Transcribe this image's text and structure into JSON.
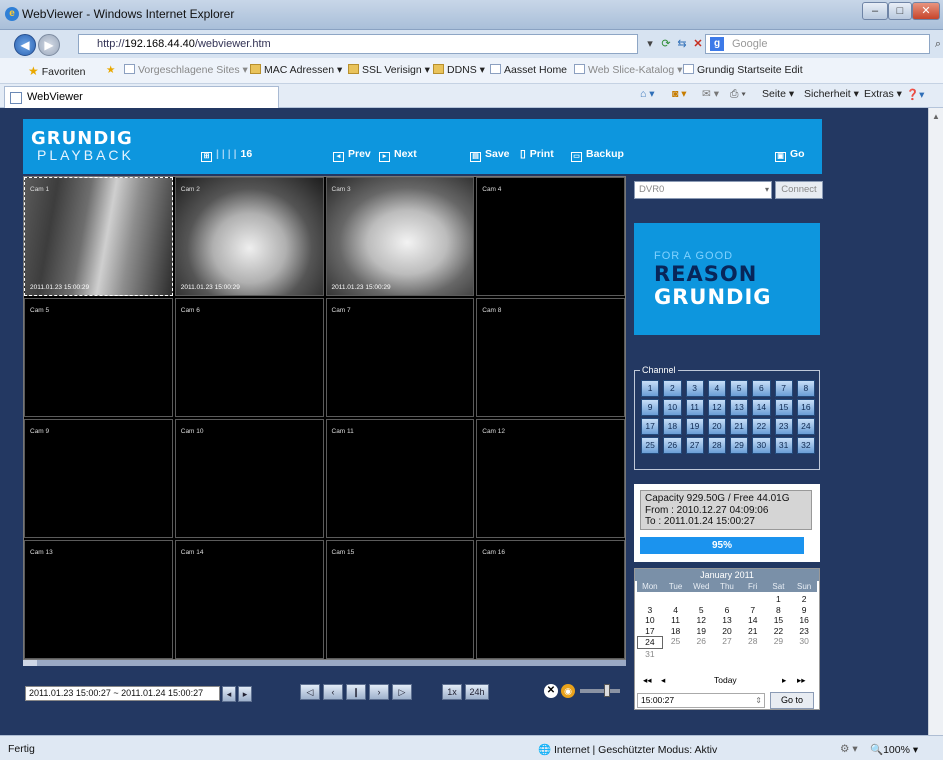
{
  "window": {
    "title": "WebViewer - Windows Internet Explorer",
    "min": "–",
    "max": "□",
    "close": "✕"
  },
  "addressbar": {
    "url_prefix": "http://",
    "url_domain": "192.168.44.40",
    "url_path": "/webviewer.htm",
    "search_placeholder": "Google"
  },
  "favorites": {
    "label": "Favoriten",
    "items": [
      "Vorgeschlagene Sites ▾",
      "MAC Adressen ▾",
      "SSL Verisign ▾",
      "DDNS ▾",
      "Aasset Home",
      "Web Slice-Katalog ▾",
      "Grundig Startseite Edit"
    ]
  },
  "tab": {
    "title": "WebViewer"
  },
  "commandbar": {
    "page": "Seite ▾",
    "security": "Sicherheit ▾",
    "extras": "Extras ▾"
  },
  "header": {
    "brand": "GRUNDIG",
    "mode": "PLAYBACK",
    "layout_label": "16",
    "prev": "Prev",
    "next": "Next",
    "save": "Save",
    "print": "Print",
    "backup": "Backup",
    "go": "Go"
  },
  "cameras": [
    {
      "label": "Cam 1",
      "timestamp": "2011.01.23 15:00:29"
    },
    {
      "label": "Cam 2",
      "timestamp": "2011.01.23 15:00:29"
    },
    {
      "label": "Cam 3",
      "timestamp": "2011.01.23 15:00:29"
    },
    {
      "label": "Cam 4",
      "timestamp": ""
    },
    {
      "label": "Cam 5",
      "timestamp": ""
    },
    {
      "label": "Cam 6",
      "timestamp": ""
    },
    {
      "label": "Cam 7",
      "timestamp": ""
    },
    {
      "label": "Cam 8",
      "timestamp": ""
    },
    {
      "label": "Cam 9",
      "timestamp": ""
    },
    {
      "label": "Cam 10",
      "timestamp": ""
    },
    {
      "label": "Cam 11",
      "timestamp": ""
    },
    {
      "label": "Cam 12",
      "timestamp": ""
    },
    {
      "label": "Cam 13",
      "timestamp": ""
    },
    {
      "label": "Cam 14",
      "timestamp": ""
    },
    {
      "label": "Cam 15",
      "timestamp": ""
    },
    {
      "label": "Cam 16",
      "timestamp": ""
    }
  ],
  "playback": {
    "time_range": "2011.01.23 15:00:27 ~ 2011.01.24 15:00:27",
    "speed": "1x",
    "span": "24h"
  },
  "dvr": {
    "selected": "DVR0",
    "connect": "Connect"
  },
  "banner": {
    "line1": "FOR A GOOD",
    "line2": "REASON",
    "line3": "GRUNDIG"
  },
  "channels": {
    "label": "Channel",
    "numbers": [
      "1",
      "2",
      "3",
      "4",
      "5",
      "6",
      "7",
      "8",
      "9",
      "10",
      "11",
      "12",
      "13",
      "14",
      "15",
      "16",
      "17",
      "18",
      "19",
      "20",
      "21",
      "22",
      "23",
      "24",
      "25",
      "26",
      "27",
      "28",
      "29",
      "30",
      "31",
      "32"
    ]
  },
  "storage": {
    "capacity": "Capacity 929.50G / Free 44.01G",
    "from": "From  : 2010.12.27 04:09:06",
    "to": "To  : 2011.01.24 15:00:27",
    "progress_label": "95%",
    "progress": 0.95
  },
  "calendar": {
    "month": "January 2011",
    "weekdays": [
      "Mon",
      "Tue",
      "Wed",
      "Thu",
      "Fri",
      "Sat",
      "Sun"
    ],
    "days": [
      "",
      "",
      "",
      "",
      "",
      "1",
      "2",
      "3",
      "4",
      "5",
      "6",
      "7",
      "8",
      "9",
      "10",
      "11",
      "12",
      "13",
      "14",
      "15",
      "16",
      "17",
      "18",
      "19",
      "20",
      "21",
      "22",
      "23",
      "24",
      "25",
      "26",
      "27",
      "28",
      "29",
      "30",
      "31"
    ],
    "today_label": "Today",
    "prev_year": "◂◂",
    "prev_month": "◂",
    "next_month": "▸",
    "next_year": "▸▸",
    "time": "15:00:27",
    "goto": "Go to"
  },
  "status": {
    "left": "Fertig",
    "zone": "Internet | Geschützter Modus: Aktiv",
    "zoom": "100%"
  }
}
